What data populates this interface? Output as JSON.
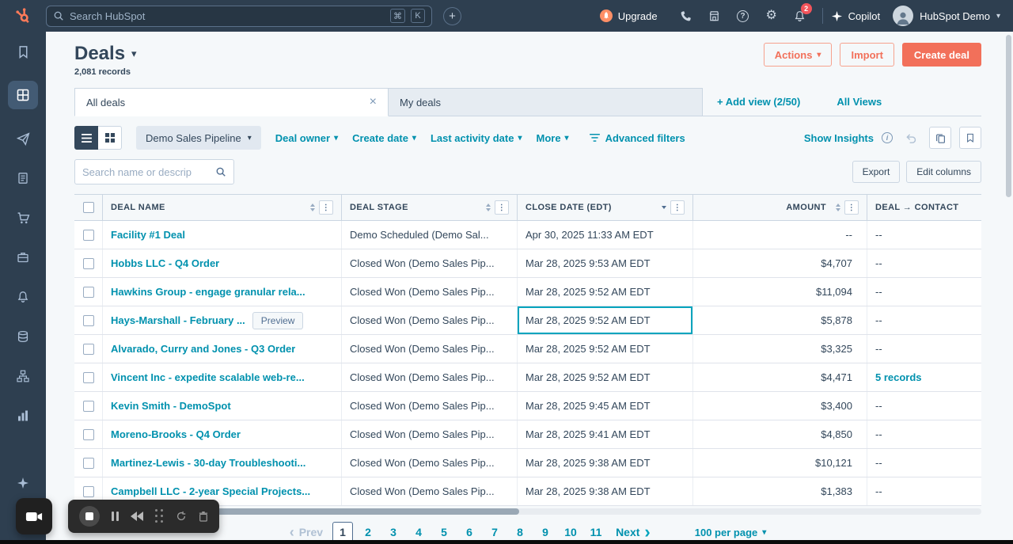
{
  "colors": {
    "topbar_bg": "#2e3f50",
    "accent_orange": "#f2705a",
    "link_teal": "#0091ae",
    "selected_cell_border": "#00a4bd",
    "badge_red": "#f2545b"
  },
  "topbar": {
    "search_placeholder": "Search HubSpot",
    "shortcut": [
      "⌘",
      "K"
    ],
    "upgrade_label": "Upgrade",
    "copilot_label": "Copilot",
    "account_label": "HubSpot Demo",
    "notification_count": "2"
  },
  "sidebar": {
    "icons": [
      "bookmark",
      "crm-table",
      "paper-plane",
      "document",
      "cart",
      "briefcase",
      "bell",
      "database",
      "workflow",
      "bar-chart",
      "sparkle",
      "code"
    ],
    "active_icon": "crm-table"
  },
  "page": {
    "title": "Deals",
    "records": "2,081 records",
    "actions_label": "Actions",
    "import_label": "Import",
    "create_label": "Create deal"
  },
  "views": {
    "tabs": [
      {
        "label": "All deals"
      },
      {
        "label": "My deals"
      }
    ],
    "add_view_label": "+ Add view (2/50)",
    "all_views_label": "All Views"
  },
  "toolbar": {
    "pipeline_label": "Demo Sales Pipeline",
    "filters": [
      "Deal owner",
      "Create date",
      "Last activity date",
      "More"
    ],
    "advanced_filters_label": "Advanced filters",
    "show_insights_label": "Show Insights"
  },
  "controls": {
    "search_placeholder": "Search name or descrip",
    "export_label": "Export",
    "edit_columns_label": "Edit columns"
  },
  "table": {
    "columns": [
      "DEAL NAME",
      "DEAL STAGE",
      "CLOSE DATE (EDT)",
      "AMOUNT",
      "DEAL → CONTACT"
    ],
    "preview_label": "Preview",
    "rows": [
      {
        "name": "Facility #1 Deal",
        "stage": "Demo Scheduled (Demo Sal...",
        "close": "Apr 30, 2025 11:33 AM EDT",
        "amount": "--",
        "contact": "--"
      },
      {
        "name": "Hobbs LLC - Q4 Order",
        "stage": "Closed Won (Demo Sales Pip...",
        "close": "Mar 28, 2025 9:53 AM EDT",
        "amount": "$4,707",
        "contact": "--"
      },
      {
        "name": "Hawkins Group - engage granular rela...",
        "stage": "Closed Won (Demo Sales Pip...",
        "close": "Mar 28, 2025 9:52 AM EDT",
        "amount": "$11,094",
        "contact": "--"
      },
      {
        "name": "Hays-Marshall - February ...",
        "stage": "Closed Won (Demo Sales Pip...",
        "close": "Mar 28, 2025 9:52 AM EDT",
        "amount": "$5,878",
        "contact": "--",
        "preview": true,
        "selected": "close"
      },
      {
        "name": "Alvarado, Curry and Jones - Q3 Order",
        "stage": "Closed Won (Demo Sales Pip...",
        "close": "Mar 28, 2025 9:52 AM EDT",
        "amount": "$3,325",
        "contact": "--"
      },
      {
        "name": "Vincent Inc - expedite scalable web-re...",
        "stage": "Closed Won (Demo Sales Pip...",
        "close": "Mar 28, 2025 9:52 AM EDT",
        "amount": "$4,471",
        "contact": "5 records",
        "contact_is_link": true
      },
      {
        "name": "Kevin Smith - DemoSpot",
        "stage": "Closed Won (Demo Sales Pip...",
        "close": "Mar 28, 2025 9:45 AM EDT",
        "amount": "$3,400",
        "contact": "--"
      },
      {
        "name": "Moreno-Brooks - Q4 Order",
        "stage": "Closed Won (Demo Sales Pip...",
        "close": "Mar 28, 2025 9:41 AM EDT",
        "amount": "$4,850",
        "contact": "--"
      },
      {
        "name": "Martinez-Lewis - 30-day Troubleshooti...",
        "stage": "Closed Won (Demo Sales Pip...",
        "close": "Mar 28, 2025 9:38 AM EDT",
        "amount": "$10,121",
        "contact": "--"
      },
      {
        "name": "Campbell LLC - 2-year Special Projects...",
        "stage": "Closed Won (Demo Sales Pip...",
        "close": "Mar 28, 2025 9:38 AM EDT",
        "amount": "$1,383",
        "contact": "--"
      }
    ]
  },
  "pagination": {
    "prev_label": "Prev",
    "next_label": "Next",
    "pages": [
      "1",
      "2",
      "3",
      "4",
      "5",
      "6",
      "7",
      "8",
      "9",
      "10",
      "11"
    ],
    "active_page": "1",
    "per_page_label": "100 per page"
  }
}
